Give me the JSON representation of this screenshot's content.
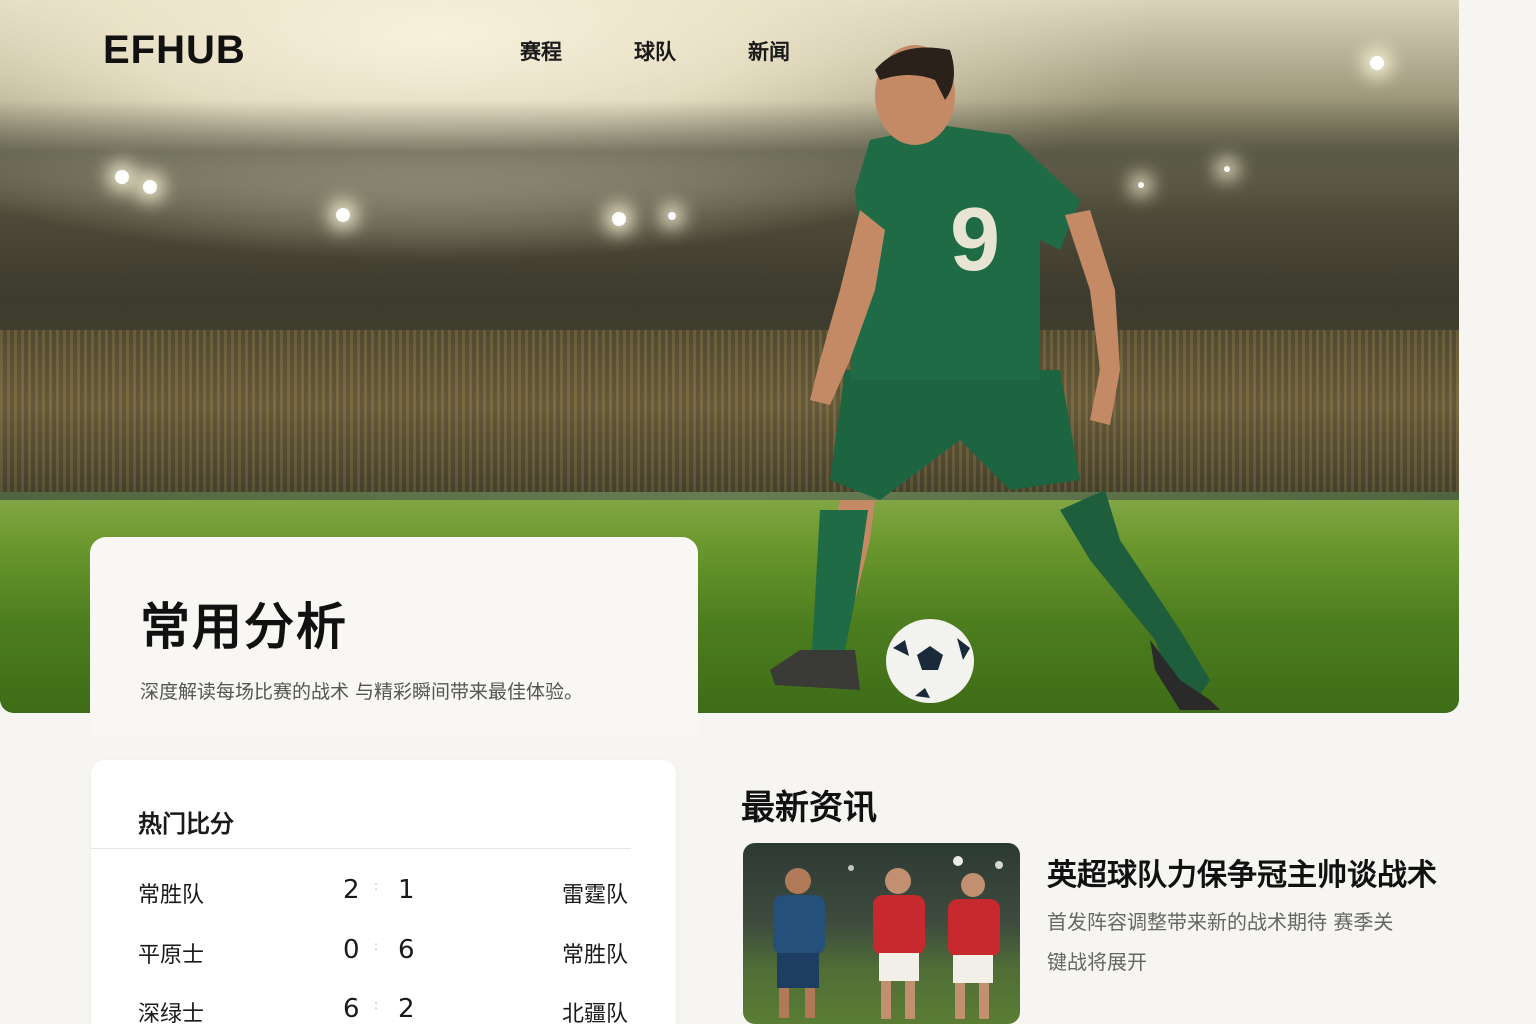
{
  "brand": {
    "logo": "EFHUB"
  },
  "nav": {
    "items": [
      "赛程",
      "球队",
      "新闻"
    ]
  },
  "hero": {
    "title": "常用分析",
    "subtitle": "深度解读每场比赛的战术 与精彩瞬间带来最佳体验。",
    "player_number": "9"
  },
  "scores": {
    "title": "热门比分",
    "rows": [
      {
        "home": "常胜队",
        "home_score": "2",
        "sep": ":",
        "away_score": "1",
        "away": "雷霆队"
      },
      {
        "home": "平原士",
        "home_score": "0",
        "sep": ":",
        "away_score": "6",
        "away": "常胜队"
      },
      {
        "home": "深绿士",
        "home_score": "6",
        "sep": ":",
        "away_score": "2",
        "away": "北疆队"
      }
    ]
  },
  "news": {
    "title": "最新资讯",
    "headline": "英超球队力保争冠主帅谈战术",
    "description": "首发阵容调整带来新的战术期待 赛季关键战将展开"
  },
  "colors": {
    "accent": "#1f6b45",
    "pitch": "#4c7d1e",
    "background": "#f6f5f2"
  }
}
